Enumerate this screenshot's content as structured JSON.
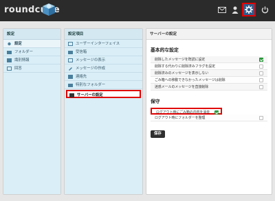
{
  "app": {
    "logo_text": "roundcube"
  },
  "topbar": {
    "icons": [
      "mail-icon",
      "contacts-icon",
      "settings-icon",
      "power-icon"
    ]
  },
  "left_panel": {
    "header": "設定",
    "items": [
      {
        "label": "設定",
        "icon": "gear-icon"
      },
      {
        "label": "フォルダー",
        "icon": "folder-icon"
      },
      {
        "label": "識別情報",
        "icon": "identity-icon"
      },
      {
        "label": "回答",
        "icon": "responses-icon"
      }
    ]
  },
  "middle_panel": {
    "header": "設定項目",
    "items": [
      {
        "label": "ユーザーインターフェイス",
        "icon": "ui-icon"
      },
      {
        "label": "受信箱",
        "icon": "inbox-icon"
      },
      {
        "label": "メッセージの表示",
        "icon": "display-icon"
      },
      {
        "label": "メッセージの作成",
        "icon": "compose-icon"
      },
      {
        "label": "連絡先",
        "icon": "contacts-icon"
      },
      {
        "label": "特別なフォルダー",
        "icon": "folder-icon"
      },
      {
        "label": "サーバーの設定",
        "icon": "server-icon"
      }
    ]
  },
  "right_panel": {
    "header": "サーバーの設定",
    "basic": {
      "title": "基本的な設定",
      "rows": [
        {
          "label": "削除したメッセージを既読に設定",
          "checked": true
        },
        {
          "label": "削除する代わりに削除済みフラグを設定",
          "checked": false
        },
        {
          "label": "削除済みのメッセージを表示しない",
          "checked": false
        },
        {
          "label": "ごみ箱への移動できなかったメッセージは削除",
          "checked": false
        },
        {
          "label": "迷惑メールのメッセージを直接削除",
          "checked": false
        }
      ]
    },
    "maintenance": {
      "title": "保守",
      "rows": [
        {
          "label": "ログアウト時にごみ箱の内容を消去",
          "checked": true
        },
        {
          "label": "ログアウト時にフォルダーを整理",
          "checked": false
        }
      ]
    },
    "save_label": "保存"
  },
  "colors": {
    "highlight": "#e00000",
    "checked": "#30a040",
    "list_bg": "#d9eef7"
  }
}
